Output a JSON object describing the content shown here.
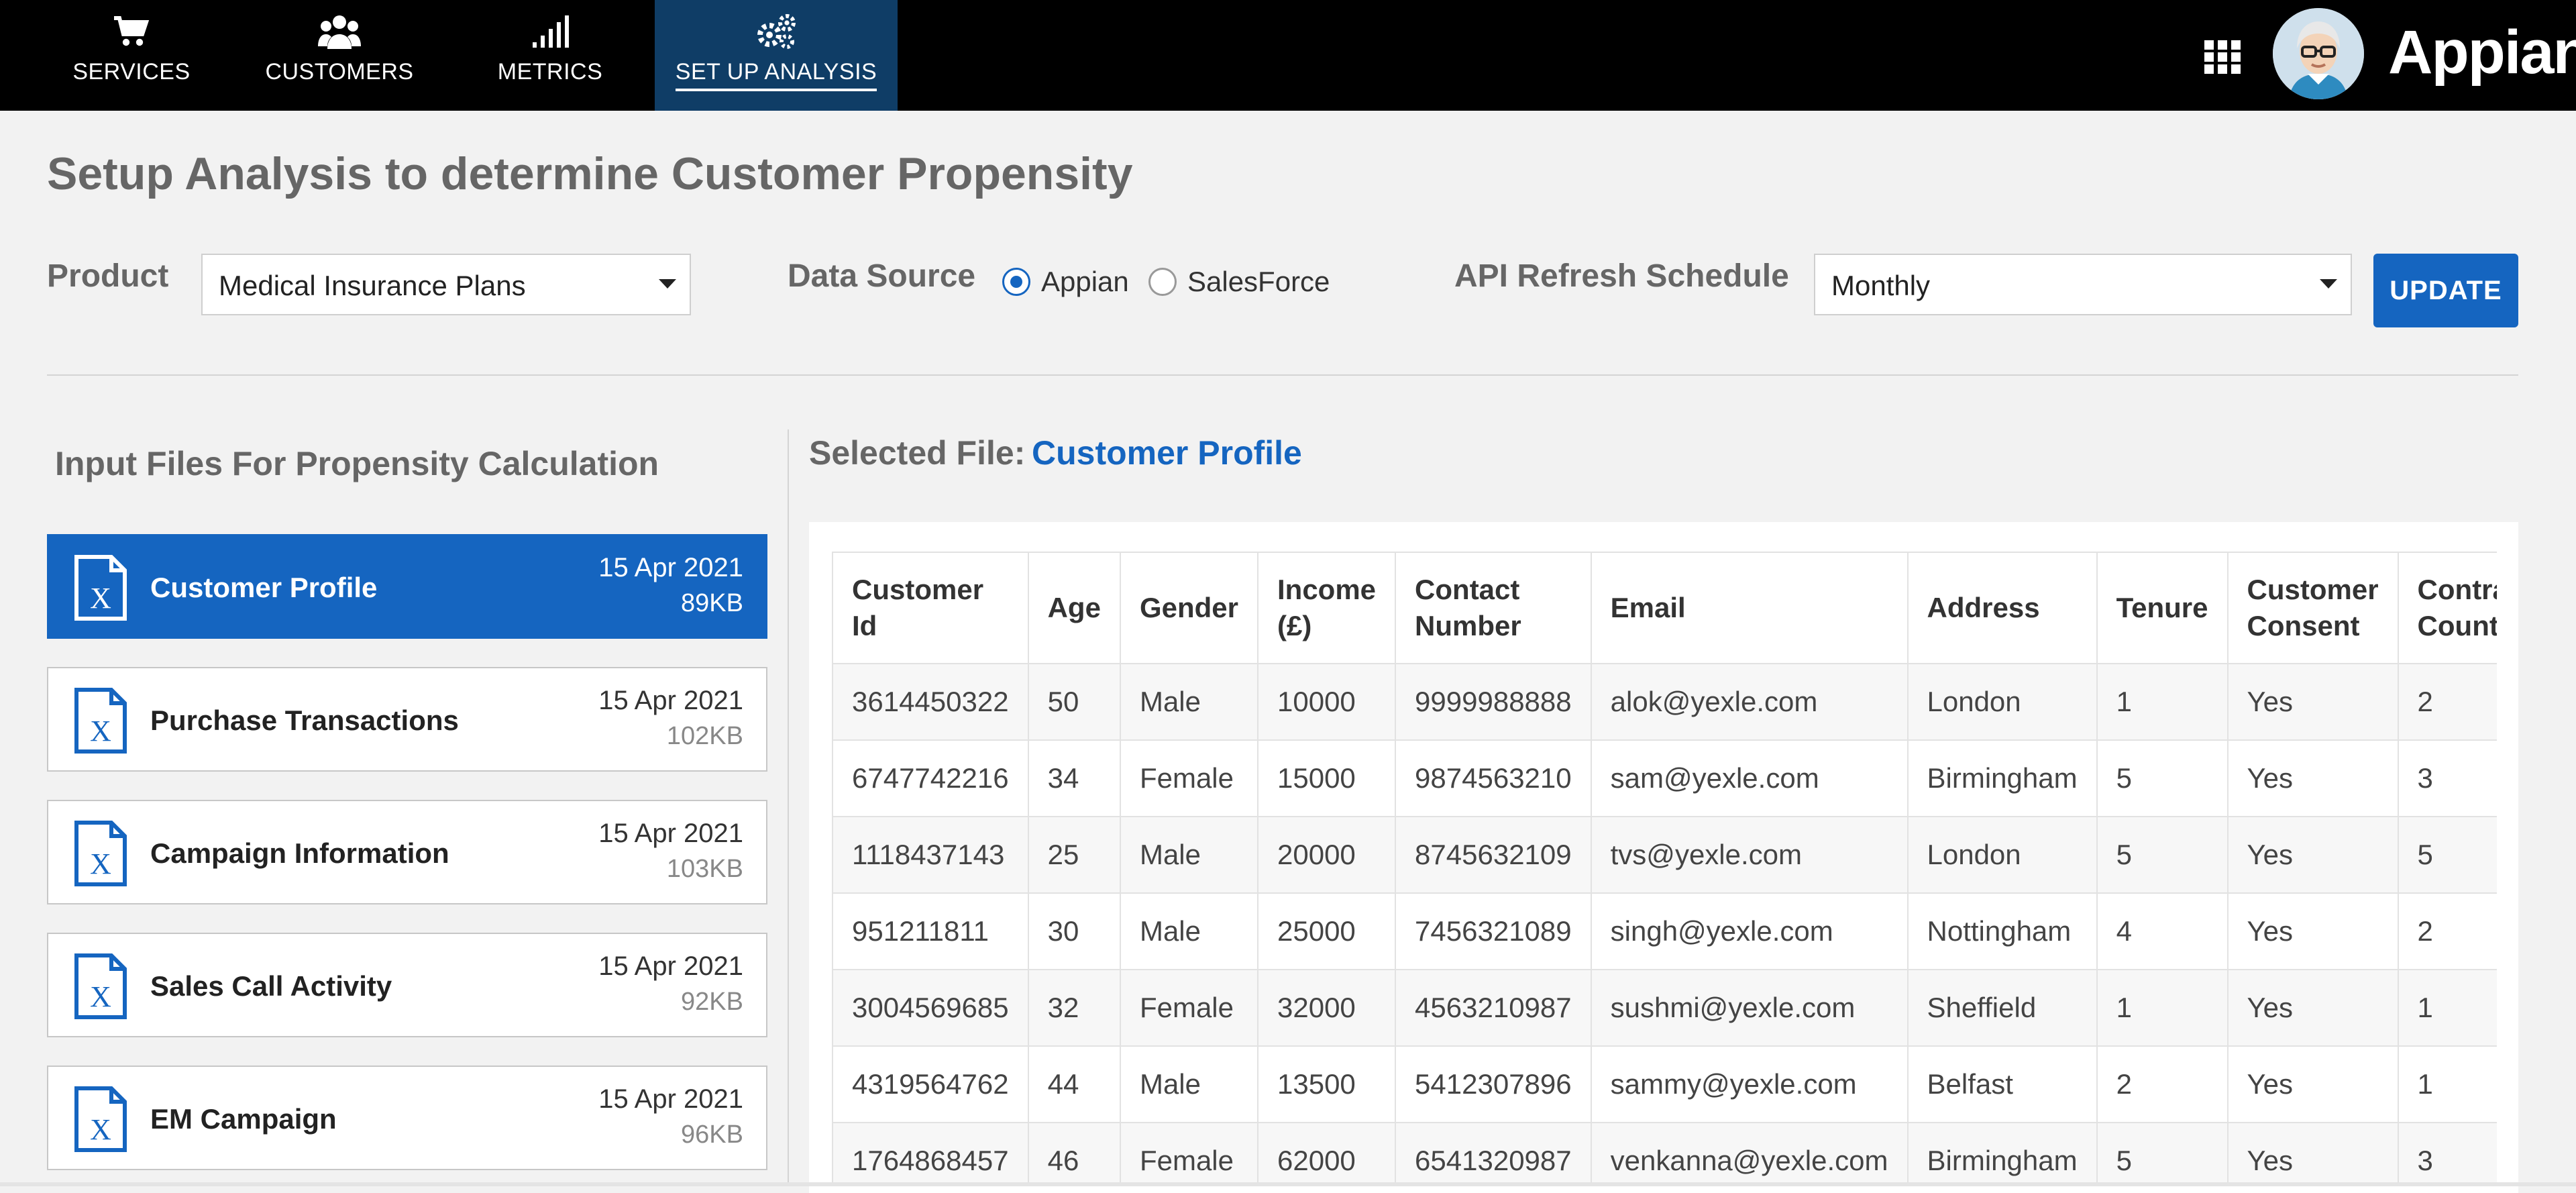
{
  "nav": {
    "tabs": [
      {
        "label": "SERVICES",
        "icon": "cart-icon"
      },
      {
        "label": "CUSTOMERS",
        "icon": "people-icon"
      },
      {
        "label": "METRICS",
        "icon": "signal-bars-icon"
      },
      {
        "label": "SET UP ANALYSIS",
        "icon": "gears-icon",
        "active": true
      }
    ],
    "brand": "Appian"
  },
  "page": {
    "title": "Setup Analysis to determine Customer Propensity"
  },
  "form": {
    "product_label": "Product",
    "product_value": "Medical Insurance Plans",
    "datasource_label": "Data Source",
    "datasource_options": [
      {
        "label": "Appian",
        "checked": true
      },
      {
        "label": "SalesForce",
        "checked": false
      }
    ],
    "refresh_label": "API Refresh Schedule",
    "refresh_value": "Monthly",
    "update_label": "UPDATE"
  },
  "files": {
    "title": "Input Files For Propensity Calculation",
    "items": [
      {
        "name": "Customer Profile",
        "date": "15 Apr 2021",
        "size": "89KB",
        "selected": true
      },
      {
        "name": "Purchase Transactions",
        "date": "15 Apr 2021",
        "size": "102KB"
      },
      {
        "name": "Campaign Information",
        "date": "15 Apr 2021",
        "size": "103KB"
      },
      {
        "name": "Sales Call Activity",
        "date": "15 Apr 2021",
        "size": "92KB"
      },
      {
        "name": "EM Campaign",
        "date": "15 Apr 2021",
        "size": "96KB"
      }
    ]
  },
  "selected": {
    "label": "Selected File:",
    "value": "Customer Profile"
  },
  "table": {
    "headers": [
      "Customer Id",
      "Age",
      "Gender",
      "Income (£)",
      "Contact Number",
      "Email",
      "Address",
      "Tenure",
      "Customer Consent",
      "Contract Count"
    ],
    "rows": [
      [
        "3614450322",
        "50",
        "Male",
        "10000",
        "9999988888",
        "alok@yexle.com",
        "London",
        "1",
        "Yes",
        "2"
      ],
      [
        "6747742216",
        "34",
        "Female",
        "15000",
        "9874563210",
        "sam@yexle.com",
        "Birmingham",
        "5",
        "Yes",
        "3"
      ],
      [
        "1118437143",
        "25",
        "Male",
        "20000",
        "8745632109",
        "tvs@yexle.com",
        "London",
        "5",
        "Yes",
        "5"
      ],
      [
        "951211811",
        "30",
        "Male",
        "25000",
        "7456321089",
        "singh@yexle.com",
        "Nottingham",
        "4",
        "Yes",
        "2"
      ],
      [
        "3004569685",
        "32",
        "Female",
        "32000",
        "4563210987",
        "sushmi@yexle.com",
        "Sheffield",
        "1",
        "Yes",
        "1"
      ],
      [
        "4319564762",
        "44",
        "Male",
        "13500",
        "5412307896",
        "sammy@yexle.com",
        "Belfast",
        "2",
        "Yes",
        "1"
      ],
      [
        "1764868457",
        "46",
        "Female",
        "62000",
        "6541320987",
        "venkanna@yexle.com",
        "Birmingham",
        "5",
        "Yes",
        "3"
      ]
    ]
  },
  "colors": {
    "accent": "#1565c0",
    "nav_bg": "#000000",
    "nav_active_bg": "#0f3d66"
  }
}
